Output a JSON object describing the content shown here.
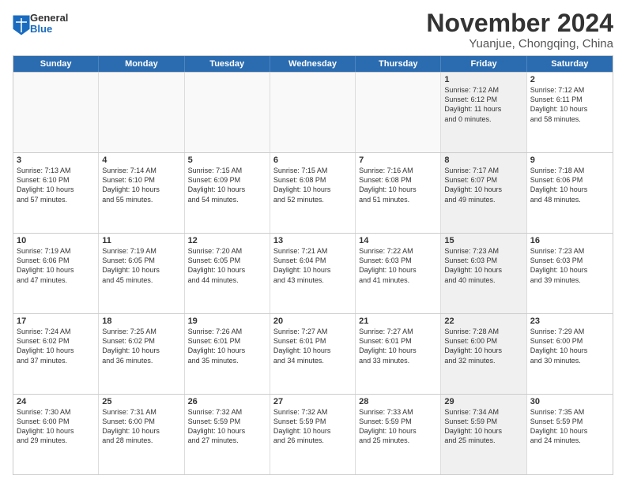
{
  "logo": {
    "general": "General",
    "blue": "Blue"
  },
  "title": "November 2024",
  "subtitle": "Yuanjue, Chongqing, China",
  "headers": [
    "Sunday",
    "Monday",
    "Tuesday",
    "Wednesday",
    "Thursday",
    "Friday",
    "Saturday"
  ],
  "weeks": [
    [
      {
        "day": "",
        "info": "",
        "empty": true
      },
      {
        "day": "",
        "info": "",
        "empty": true
      },
      {
        "day": "",
        "info": "",
        "empty": true
      },
      {
        "day": "",
        "info": "",
        "empty": true
      },
      {
        "day": "",
        "info": "",
        "empty": true
      },
      {
        "day": "1",
        "info": "Sunrise: 7:12 AM\nSunset: 6:12 PM\nDaylight: 11 hours\nand 0 minutes.",
        "shaded": true
      },
      {
        "day": "2",
        "info": "Sunrise: 7:12 AM\nSunset: 6:11 PM\nDaylight: 10 hours\nand 58 minutes.",
        "shaded": false
      }
    ],
    [
      {
        "day": "3",
        "info": "Sunrise: 7:13 AM\nSunset: 6:10 PM\nDaylight: 10 hours\nand 57 minutes."
      },
      {
        "day": "4",
        "info": "Sunrise: 7:14 AM\nSunset: 6:10 PM\nDaylight: 10 hours\nand 55 minutes."
      },
      {
        "day": "5",
        "info": "Sunrise: 7:15 AM\nSunset: 6:09 PM\nDaylight: 10 hours\nand 54 minutes."
      },
      {
        "day": "6",
        "info": "Sunrise: 7:15 AM\nSunset: 6:08 PM\nDaylight: 10 hours\nand 52 minutes."
      },
      {
        "day": "7",
        "info": "Sunrise: 7:16 AM\nSunset: 6:08 PM\nDaylight: 10 hours\nand 51 minutes."
      },
      {
        "day": "8",
        "info": "Sunrise: 7:17 AM\nSunset: 6:07 PM\nDaylight: 10 hours\nand 49 minutes.",
        "shaded": true
      },
      {
        "day": "9",
        "info": "Sunrise: 7:18 AM\nSunset: 6:06 PM\nDaylight: 10 hours\nand 48 minutes."
      }
    ],
    [
      {
        "day": "10",
        "info": "Sunrise: 7:19 AM\nSunset: 6:06 PM\nDaylight: 10 hours\nand 47 minutes."
      },
      {
        "day": "11",
        "info": "Sunrise: 7:19 AM\nSunset: 6:05 PM\nDaylight: 10 hours\nand 45 minutes."
      },
      {
        "day": "12",
        "info": "Sunrise: 7:20 AM\nSunset: 6:05 PM\nDaylight: 10 hours\nand 44 minutes."
      },
      {
        "day": "13",
        "info": "Sunrise: 7:21 AM\nSunset: 6:04 PM\nDaylight: 10 hours\nand 43 minutes."
      },
      {
        "day": "14",
        "info": "Sunrise: 7:22 AM\nSunset: 6:03 PM\nDaylight: 10 hours\nand 41 minutes."
      },
      {
        "day": "15",
        "info": "Sunrise: 7:23 AM\nSunset: 6:03 PM\nDaylight: 10 hours\nand 40 minutes.",
        "shaded": true
      },
      {
        "day": "16",
        "info": "Sunrise: 7:23 AM\nSunset: 6:03 PM\nDaylight: 10 hours\nand 39 minutes."
      }
    ],
    [
      {
        "day": "17",
        "info": "Sunrise: 7:24 AM\nSunset: 6:02 PM\nDaylight: 10 hours\nand 37 minutes."
      },
      {
        "day": "18",
        "info": "Sunrise: 7:25 AM\nSunset: 6:02 PM\nDaylight: 10 hours\nand 36 minutes."
      },
      {
        "day": "19",
        "info": "Sunrise: 7:26 AM\nSunset: 6:01 PM\nDaylight: 10 hours\nand 35 minutes."
      },
      {
        "day": "20",
        "info": "Sunrise: 7:27 AM\nSunset: 6:01 PM\nDaylight: 10 hours\nand 34 minutes."
      },
      {
        "day": "21",
        "info": "Sunrise: 7:27 AM\nSunset: 6:01 PM\nDaylight: 10 hours\nand 33 minutes."
      },
      {
        "day": "22",
        "info": "Sunrise: 7:28 AM\nSunset: 6:00 PM\nDaylight: 10 hours\nand 32 minutes.",
        "shaded": true
      },
      {
        "day": "23",
        "info": "Sunrise: 7:29 AM\nSunset: 6:00 PM\nDaylight: 10 hours\nand 30 minutes."
      }
    ],
    [
      {
        "day": "24",
        "info": "Sunrise: 7:30 AM\nSunset: 6:00 PM\nDaylight: 10 hours\nand 29 minutes."
      },
      {
        "day": "25",
        "info": "Sunrise: 7:31 AM\nSunset: 6:00 PM\nDaylight: 10 hours\nand 28 minutes."
      },
      {
        "day": "26",
        "info": "Sunrise: 7:32 AM\nSunset: 5:59 PM\nDaylight: 10 hours\nand 27 minutes."
      },
      {
        "day": "27",
        "info": "Sunrise: 7:32 AM\nSunset: 5:59 PM\nDaylight: 10 hours\nand 26 minutes."
      },
      {
        "day": "28",
        "info": "Sunrise: 7:33 AM\nSunset: 5:59 PM\nDaylight: 10 hours\nand 25 minutes."
      },
      {
        "day": "29",
        "info": "Sunrise: 7:34 AM\nSunset: 5:59 PM\nDaylight: 10 hours\nand 25 minutes.",
        "shaded": true
      },
      {
        "day": "30",
        "info": "Sunrise: 7:35 AM\nSunset: 5:59 PM\nDaylight: 10 hours\nand 24 minutes."
      }
    ]
  ]
}
